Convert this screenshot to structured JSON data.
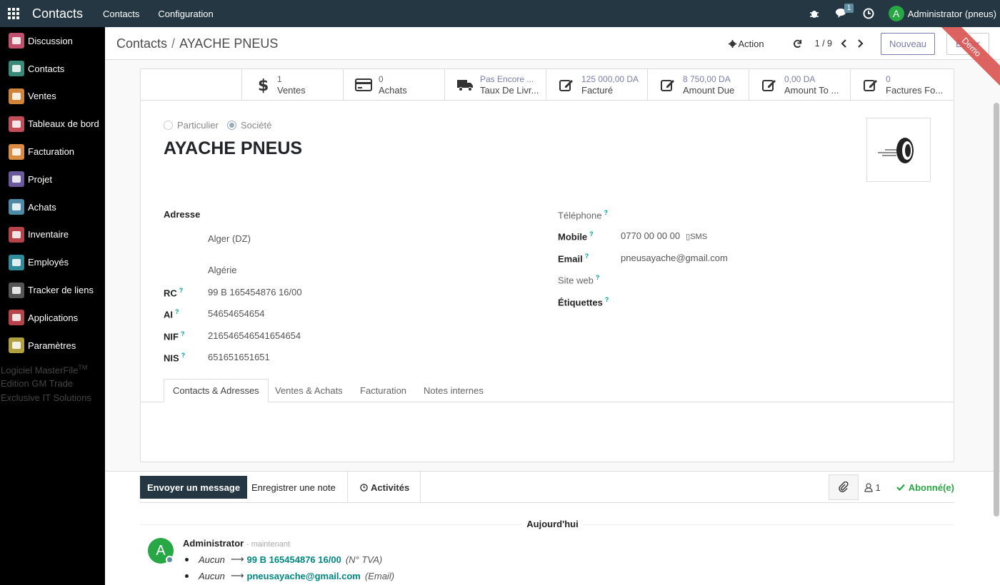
{
  "topbar": {
    "brand": "Contacts",
    "menu": [
      "Contacts",
      "Configuration"
    ],
    "chat_badge": "1",
    "user_initial": "A",
    "user_name": "Administrator (pneus)"
  },
  "sidebar": {
    "items": [
      {
        "label": "Discussion",
        "color": "#c0506d"
      },
      {
        "label": "Contacts",
        "color": "#3a8a7a"
      },
      {
        "label": "Ventes",
        "color": "#d0843a"
      },
      {
        "label": "Tableaux de bord",
        "color": "#c14d59"
      },
      {
        "label": "Facturation",
        "color": "#d98c42"
      },
      {
        "label": "Projet",
        "color": "#6a5a9c"
      },
      {
        "label": "Achats",
        "color": "#4e8aa6"
      },
      {
        "label": "Inventaire",
        "color": "#b6424a"
      },
      {
        "label": "Employés",
        "color": "#2f8a9a"
      },
      {
        "label": "Tracker de liens",
        "color": "#555555"
      },
      {
        "label": "Applications",
        "color": "#b6424a"
      },
      {
        "label": "Paramètres",
        "color": "#b0a040"
      }
    ],
    "footer": [
      "Logiciel MasterFile",
      "TM",
      "Edition GM Trade",
      "Exclusive IT Solutions"
    ]
  },
  "control_panel": {
    "breadcrumb_root": "Contacts",
    "breadcrumb_sep": "/",
    "breadcrumb_current": "AYACHE PNEUS",
    "action_label": "Action",
    "pager": "1 / 9",
    "new_label": "Nouveau",
    "edit_label": "Éditer",
    "ribbon": "Demo"
  },
  "stats": [
    {
      "value": "1",
      "label": "Ventes",
      "icon": "dollar-icon",
      "purple": false
    },
    {
      "value": "0",
      "label": "Achats",
      "icon": "credit-card-icon",
      "purple": false
    },
    {
      "value": "Pas Encore ...",
      "label": "Taux De Livr...",
      "icon": "truck-icon",
      "purple": true
    },
    {
      "value": "125 000,00 DA",
      "label": "Facturé",
      "icon": "edit-icon",
      "purple": true
    },
    {
      "value": "8 750,00 DA",
      "label": "Amount Due",
      "icon": "edit-icon",
      "purple": true
    },
    {
      "value": "0,00 DA",
      "label": "Amount To ...",
      "icon": "edit-icon",
      "purple": true
    },
    {
      "value": "0",
      "label": "Factures Fo...",
      "icon": "edit-icon",
      "purple": true
    }
  ],
  "form": {
    "radio_individual": "Particulier",
    "radio_company": "Société",
    "name": "AYACHE PNEUS",
    "address_label": "Adresse",
    "address_line1": "Alger (DZ)",
    "address_line2": "Algérie",
    "rc_label": "RC",
    "rc_value": "99 B 165454876 16/00",
    "ai_label": "AI",
    "ai_value": "54654654654",
    "nif_label": "NIF",
    "nif_value": "216546546541654654",
    "nis_label": "NIS",
    "nis_value": "651651651651",
    "phone_label": "Téléphone",
    "mobile_label": "Mobile",
    "mobile_value": "0770 00 00 00",
    "sms_label": "SMS",
    "email_label": "Email",
    "email_value": "pneusayache@gmail.com",
    "website_label": "Site web",
    "tags_label": "Étiquettes",
    "help_mark": "?"
  },
  "tabs": [
    "Contacts & Adresses",
    "Ventes & Achats",
    "Facturation",
    "Notes internes"
  ],
  "chatter": {
    "send_message": "Envoyer un message",
    "log_note": "Enregistrer une note",
    "activities": "Activités",
    "followers_count": "1",
    "following": "Abonné(e)",
    "today": "Aujourd'hui",
    "message": {
      "avatar": "A",
      "author": "Administrator",
      "time": "- maintenant",
      "changes": [
        {
          "old": "Aucun",
          "new": "99 B 165454876 16/00",
          "field": "(N° TVA)"
        },
        {
          "old": "Aucun",
          "new": "pneusayache@gmail.com",
          "field": "(Email)"
        }
      ]
    }
  }
}
